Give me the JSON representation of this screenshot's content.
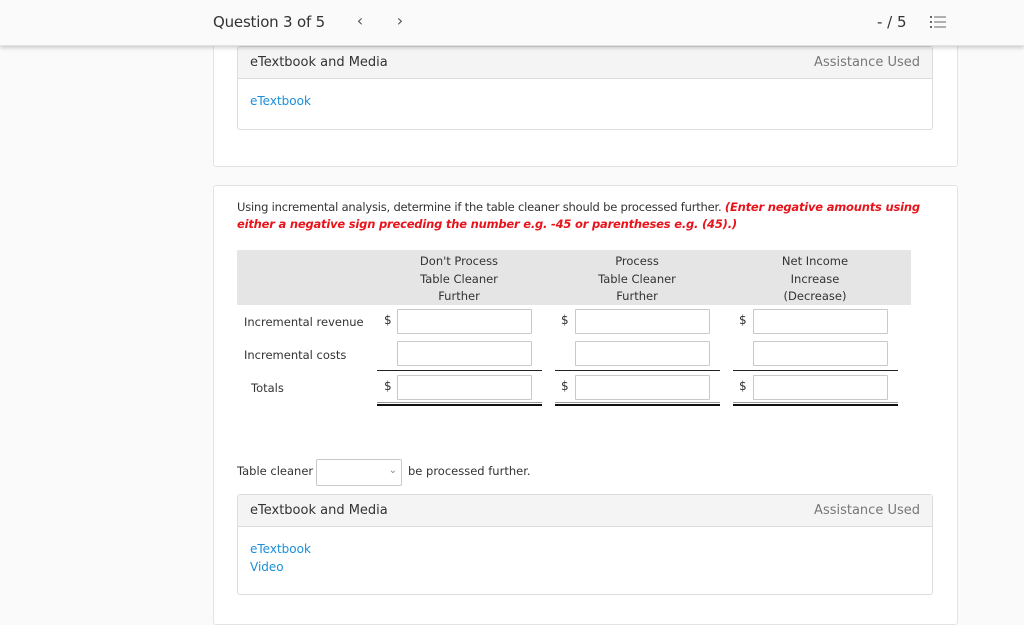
{
  "header": {
    "question_label": "Question 3 of 5",
    "prev_icon": "‹",
    "next_icon": "›",
    "score": "- / 5",
    "list_icon": "question-list-icon"
  },
  "top_media": {
    "title": "eTextbook and Media",
    "assistance": "Assistance Used",
    "links": [
      "eTextbook"
    ]
  },
  "question": {
    "instruction": "Using incremental analysis, determine if the table cleaner should be processed further.",
    "warning": "(Enter negative amounts using either a negative sign preceding the number e.g. -45 or parentheses e.g. (45).)"
  },
  "table": {
    "columns": [
      [
        "Don't Process",
        "Table Cleaner",
        "Further"
      ],
      [
        "Process",
        "Table Cleaner",
        "Further"
      ],
      [
        "Net Income",
        "Increase",
        "(Decrease)"
      ]
    ],
    "rows": [
      {
        "label": "Incremental revenue",
        "currency": "$",
        "values": [
          "",
          "",
          ""
        ]
      },
      {
        "label": "Incremental costs",
        "currency": "",
        "values": [
          "",
          "",
          ""
        ]
      },
      {
        "label": "Totals",
        "currency": "$",
        "values": [
          "",
          "",
          ""
        ]
      }
    ]
  },
  "conclusion": {
    "prefix": "Table cleaner",
    "selected": "",
    "suffix": "be processed further."
  },
  "bottom_media": {
    "title": "eTextbook and Media",
    "assistance": "Assistance Used",
    "links": [
      "eTextbook",
      "Video"
    ]
  }
}
